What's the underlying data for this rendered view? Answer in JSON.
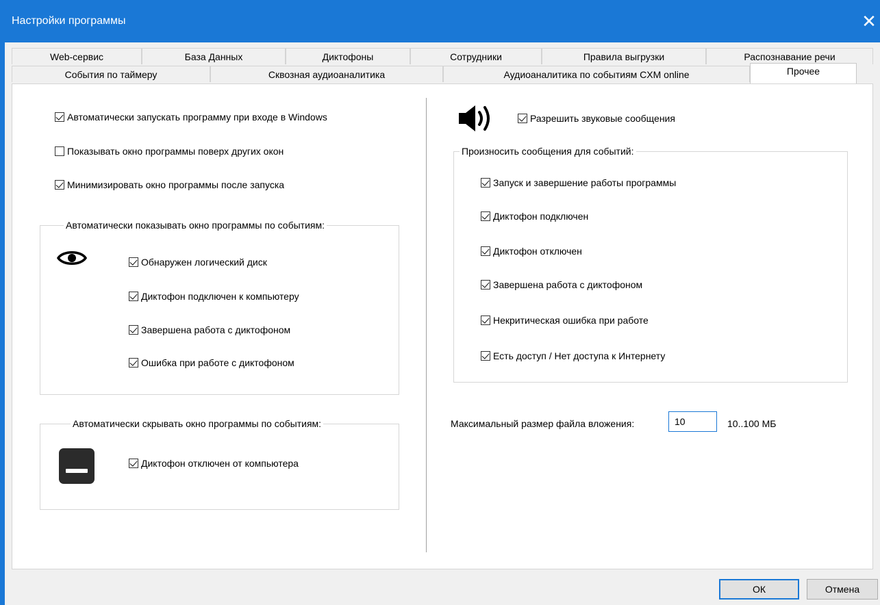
{
  "window": {
    "title": "Настройки программы",
    "close_symbol": "✕"
  },
  "tabs": {
    "row1": [
      "Web-сервис",
      "База Данных",
      "Диктофоны",
      "Сотрудники",
      "Правила выгрузки",
      "Распознавание речи"
    ],
    "row2": [
      "События по таймеру",
      "Сквозная аудиоаналитика",
      "Аудиоаналитика по событиям CXM online",
      "Прочее"
    ],
    "active": "Прочее"
  },
  "left": {
    "opt_autostart": {
      "label": "Автоматически запускать программу при входе в Windows",
      "checked": true
    },
    "opt_on_top": {
      "label": "Показывать окно программы поверх других окон",
      "checked": false
    },
    "opt_minimize": {
      "label": "Минимизировать окно программы после запуска",
      "checked": true
    },
    "show_group": {
      "title": "Автоматически показывать окно программы по событиям:",
      "icon": "eye-icon",
      "items": [
        {
          "label": "Обнаружен логический диск",
          "checked": true
        },
        {
          "label": "Диктофон подключен к компьютеру",
          "checked": true
        },
        {
          "label": "Завершена работа с диктофоном",
          "checked": true
        },
        {
          "label": "Ошибка при работе с диктофоном",
          "checked": true
        }
      ]
    },
    "hide_group": {
      "title": "Автоматически скрывать окно программы по событиям:",
      "icon": "minimize-window-icon",
      "items": [
        {
          "label": "Диктофон отключен от компьютера",
          "checked": true
        }
      ]
    }
  },
  "right": {
    "sound": {
      "label": "Разрешить звуковые сообщения",
      "checked": true,
      "icon": "speaker-icon"
    },
    "speak_group": {
      "title": "Произносить сообщения для событий:",
      "items": [
        {
          "label": "Запуск и завершение работы программы",
          "checked": true
        },
        {
          "label": "Диктофон подключен",
          "checked": true
        },
        {
          "label": "Диктофон отключен",
          "checked": true
        },
        {
          "label": "Завершена работа с диктофоном",
          "checked": true
        },
        {
          "label": "Некритическая ошибка при работе",
          "checked": true
        },
        {
          "label": "Есть доступ / Нет доступа к Интернету",
          "checked": true
        }
      ]
    },
    "attachment": {
      "label": "Максимальный размер файла вложения:",
      "value": "10",
      "range": "10..100 МБ"
    }
  },
  "buttons": {
    "ok": "ОК",
    "cancel": "Отмена"
  },
  "colors": {
    "accent": "#1a78d6",
    "panel": "#ffffff",
    "background": "#f0f0f0"
  }
}
